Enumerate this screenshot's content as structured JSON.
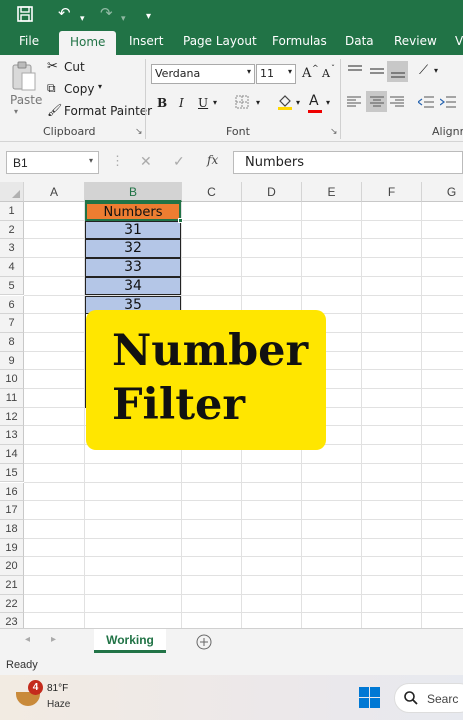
{
  "ribbon_tabs": [
    "File",
    "Home",
    "Insert",
    "Page Layout",
    "Formulas",
    "Data",
    "Review",
    "V"
  ],
  "clipboard": {
    "paste": "Paste",
    "cut": "Cut",
    "copy": "Copy",
    "format_painter": "Format Painter",
    "group": "Clipboard"
  },
  "font": {
    "name": "Verdana",
    "size": "11",
    "grow": "A",
    "shrink": "A",
    "bold": "B",
    "italic": "I",
    "underline": "U",
    "color_a": "A",
    "group": "Font"
  },
  "alignment": {
    "group": "Alignm"
  },
  "formula_bar": {
    "name_box": "B1",
    "fx": "fx",
    "content": "Numbers"
  },
  "columns": [
    "A",
    "B",
    "C",
    "D",
    "E",
    "F",
    "G"
  ],
  "rows": [
    "1",
    "2",
    "3",
    "4",
    "5",
    "6",
    "7",
    "8",
    "9",
    "10",
    "11",
    "12",
    "13",
    "14",
    "15",
    "16",
    "17",
    "18",
    "19",
    "20",
    "21",
    "22",
    "23"
  ],
  "cells": {
    "header": "Numbers",
    "values": [
      "31",
      "32",
      "33",
      "34",
      "35"
    ]
  },
  "overlay": {
    "line1": "Number",
    "line2": "Filter"
  },
  "sheet": {
    "tab": "Working"
  },
  "status": "Ready",
  "taskbar": {
    "badge": "4",
    "temp": "81°F",
    "condition": "Haze",
    "search": "Searc"
  },
  "colors": {
    "accent": "#217346",
    "header_fill": "#ed7d31",
    "cell_fill": "#b4c6e7",
    "overlay": "#ffe600"
  }
}
